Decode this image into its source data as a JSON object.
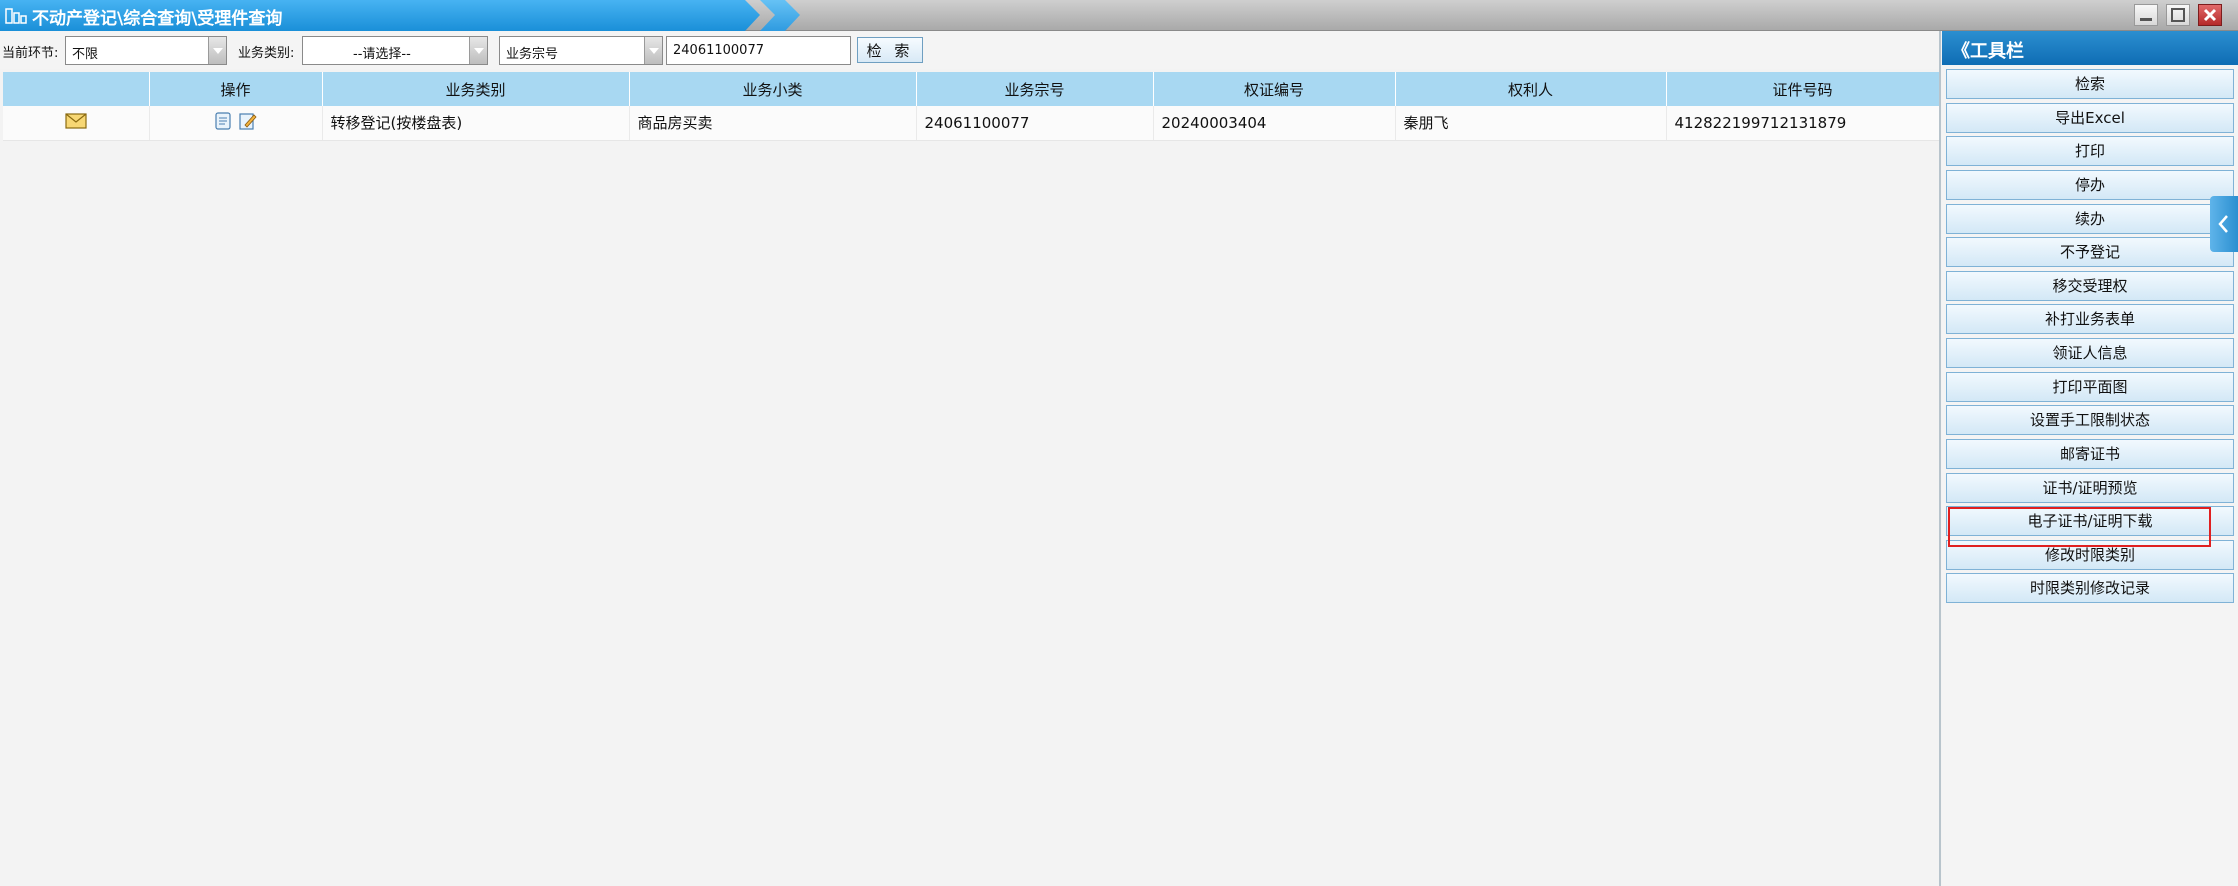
{
  "title": "不动产登记\\综合查询\\受理件查询",
  "colors": {
    "accent": "#1a8fd8",
    "header_bg": "#a8d8f2",
    "highlight": "#e02020"
  },
  "icons": {
    "title": "building-icon",
    "window_min": "minimize-icon",
    "window_max": "maximize-icon",
    "window_close": "close-icon"
  },
  "filters": {
    "stage_label": "当前环节:",
    "stage_value": "不限",
    "type_label": "业务类别:",
    "type_value": "--请选择--",
    "field_value": "业务宗号",
    "search_value": "24061100077",
    "search_button": "检 索"
  },
  "table": {
    "headers": [
      "",
      "操作",
      "业务类别",
      "业务小类",
      "业务宗号",
      "权证编号",
      "权利人",
      "证件号码"
    ],
    "rows": [
      {
        "icon": "envelope-icon",
        "ops": [
          "document-icon",
          "edit-icon"
        ],
        "category": "转移登记(按楼盘表)",
        "subcategory": "商品房买卖",
        "business_no": "24061100077",
        "cert_no": "20240003404",
        "owner": "秦朋飞",
        "id_no": "412822199712131879"
      }
    ]
  },
  "toolbar": {
    "title": "《工具栏",
    "buttons": [
      "检索",
      "导出Excel",
      "打印",
      "停办",
      "续办",
      "不予登记",
      "移交受理权",
      "补打业务表单",
      "领证人信息",
      "打印平面图",
      "设置手工限制状态",
      "邮寄证书",
      "证书/证明预览",
      "电子证书/证明下载",
      "修改时限类别",
      "时限类别修改记录"
    ],
    "highlighted_button": "电子证书/证明下载",
    "collapse_icon": "chevron-left-icon"
  }
}
